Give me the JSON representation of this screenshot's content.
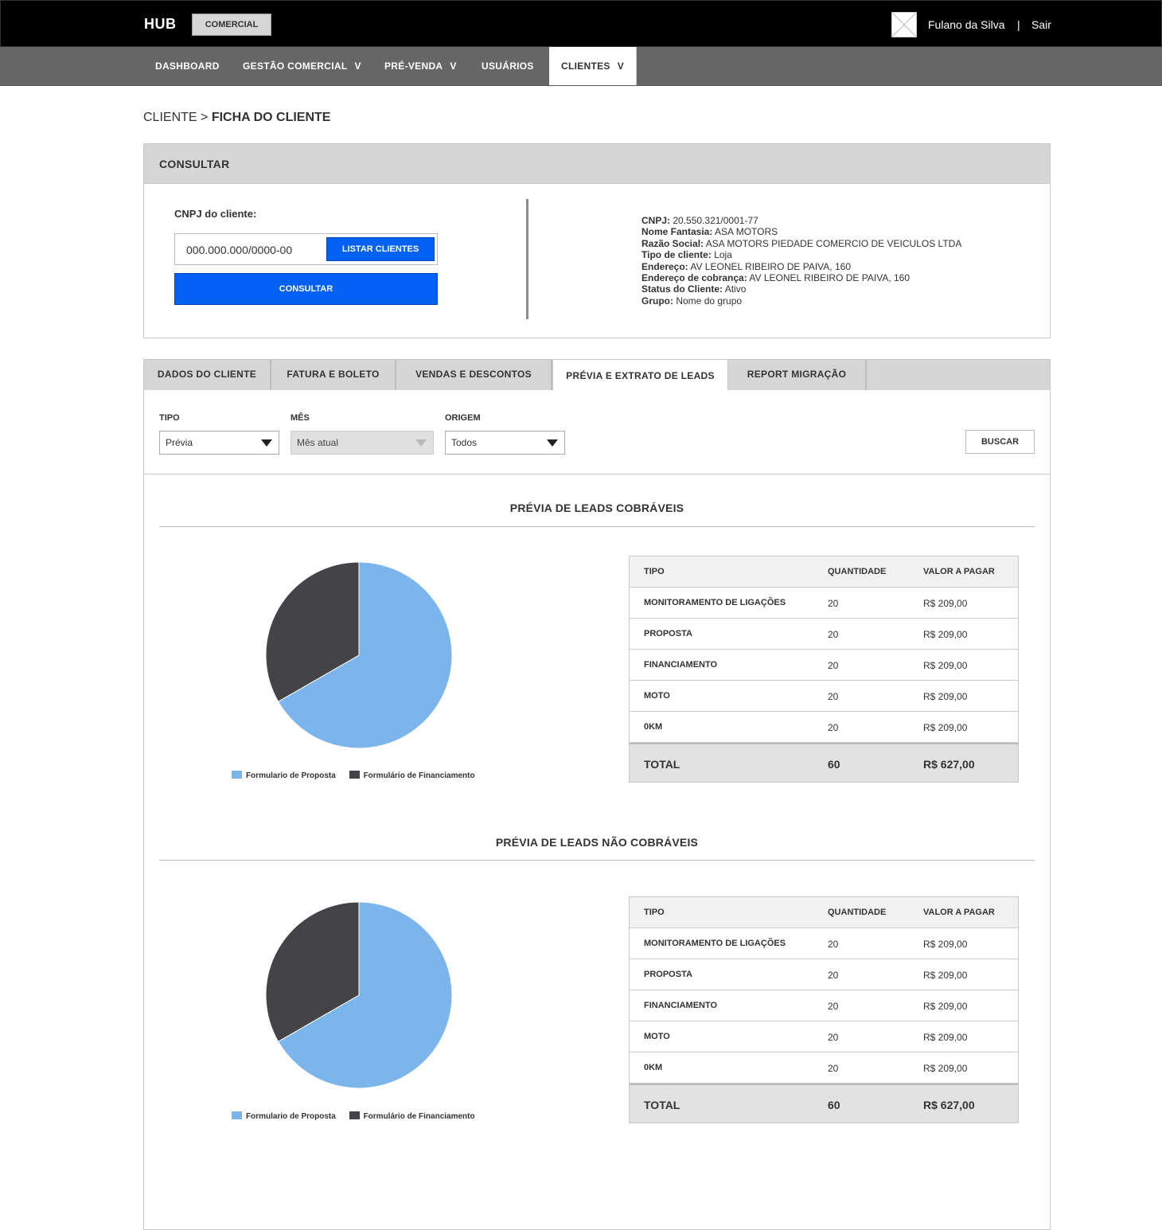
{
  "header": {
    "brand": "HUB",
    "module": "COMERCIAL",
    "user_name": "Fulano da Silva",
    "separator": "|",
    "logout": "Sair"
  },
  "nav": {
    "items": [
      {
        "label": "DASHBOARD",
        "chevron": ""
      },
      {
        "label": "GESTÃO COMERCIAL",
        "chevron": "V"
      },
      {
        "label": "PRÉ-VENDA",
        "chevron": "V"
      },
      {
        "label": "USUÁRIOS",
        "chevron": ""
      },
      {
        "label": "CLIENTES",
        "chevron": "V"
      }
    ],
    "active": "CLIENTES"
  },
  "breadcrumb": {
    "parent": "CLIENTE",
    "sep": ">",
    "current": "FICHA DO CLIENTE"
  },
  "consultar": {
    "title": "CONSULTAR",
    "cnpj_label": "CNPJ do cliente:",
    "cnpj_value": "000.000.000/0000-00",
    "list_button": "LISTAR CLIENTES",
    "consult_button": "CONSULTAR",
    "info": [
      {
        "label": "CNPJ:",
        "value": "20.550.321/0001-77"
      },
      {
        "label": "Nome Fantasia:",
        "value": "ASA MOTORS"
      },
      {
        "label": "Razão Social:",
        "value": "ASA MOTORS PIEDADE COMERCIO DE VEICULOS LTDA"
      },
      {
        "label": "Tipo de cliente:",
        "value": "Loja"
      },
      {
        "label": "Endereço:",
        "value": "AV LEONEL RIBEIRO DE PAIVA, 160"
      },
      {
        "label": "Endereço de cobrança:",
        "value": "AV LEONEL RIBEIRO DE PAIVA, 160"
      },
      {
        "label": "Status do Cliente:",
        "value": "Ativo"
      },
      {
        "label": "Grupo:",
        "value": "Nome do grupo"
      }
    ]
  },
  "tabs": [
    {
      "label": "DADOS DO CLIENTE"
    },
    {
      "label": "FATURA E BOLETO"
    },
    {
      "label": "VENDAS E DESCONTOS"
    },
    {
      "label": "PRÉVIA E EXTRATO DE LEADS"
    },
    {
      "label": "REPORT MIGRAÇÃO"
    }
  ],
  "active_tab": "PRÉVIA E EXTRATO DE LEADS",
  "filters": {
    "tipo_label": "TIPO",
    "tipo_value": "Prévia",
    "mes_label": "MÊS",
    "mes_value": "Mês atual",
    "origem_label": "ORIGEM",
    "origem_value": "Todos",
    "search_button": "BUSCAR"
  },
  "colors": {
    "accent_blue": "#0061f4",
    "pie_light": "#7cb5ec",
    "pie_dark": "#434348"
  },
  "sections": [
    {
      "title": "PRÉVIA DE LEADS COBRÁVEIS",
      "legend": [
        "Formulario de Proposta",
        "Formulário de Financiamento"
      ],
      "table": {
        "headers": [
          "TIPO",
          "QUANTIDADE",
          "VALOR A PAGAR"
        ],
        "rows": [
          [
            "MONITORAMENTO DE LIGAÇÕES",
            "20",
            "R$ 209,00"
          ],
          [
            "PROPOSTA",
            "20",
            "R$ 209,00"
          ],
          [
            "FINANCIAMENTO",
            "20",
            "R$ 209,00"
          ],
          [
            "MOTO",
            "20",
            "R$ 209,00"
          ],
          [
            "0KM",
            "20",
            "R$ 209,00"
          ]
        ],
        "total": [
          "TOTAL",
          "60",
          "R$ 627,00"
        ]
      }
    },
    {
      "title": "PRÉVIA DE LEADS NÃO COBRÁVEIS",
      "legend": [
        "Formulario de Proposta",
        "Formulário de Financiamento"
      ],
      "table": {
        "headers": [
          "TIPO",
          "QUANTIDADE",
          "VALOR A PAGAR"
        ],
        "rows": [
          [
            "MONITORAMENTO DE LIGAÇÕES",
            "20",
            "R$ 209,00"
          ],
          [
            "PROPOSTA",
            "20",
            "R$ 209,00"
          ],
          [
            "FINANCIAMENTO",
            "20",
            "R$ 209,00"
          ],
          [
            "MOTO",
            "20",
            "R$ 209,00"
          ],
          [
            "0KM",
            "20",
            "R$ 209,00"
          ]
        ],
        "total": [
          "TOTAL",
          "60",
          "R$ 627,00"
        ]
      }
    }
  ],
  "chart_data": [
    {
      "type": "pie",
      "categories": [
        "Formulario de Proposta",
        "Formulário de Financiamento"
      ],
      "values": [
        66.7,
        33.3
      ],
      "colors": [
        "#7cb5ec",
        "#434348"
      ],
      "legend": "bottom"
    },
    {
      "type": "pie",
      "categories": [
        "Formulario de Proposta",
        "Formulário de Financiamento"
      ],
      "values": [
        66.7,
        33.3
      ],
      "colors": [
        "#7cb5ec",
        "#434348"
      ],
      "legend": "bottom"
    }
  ]
}
